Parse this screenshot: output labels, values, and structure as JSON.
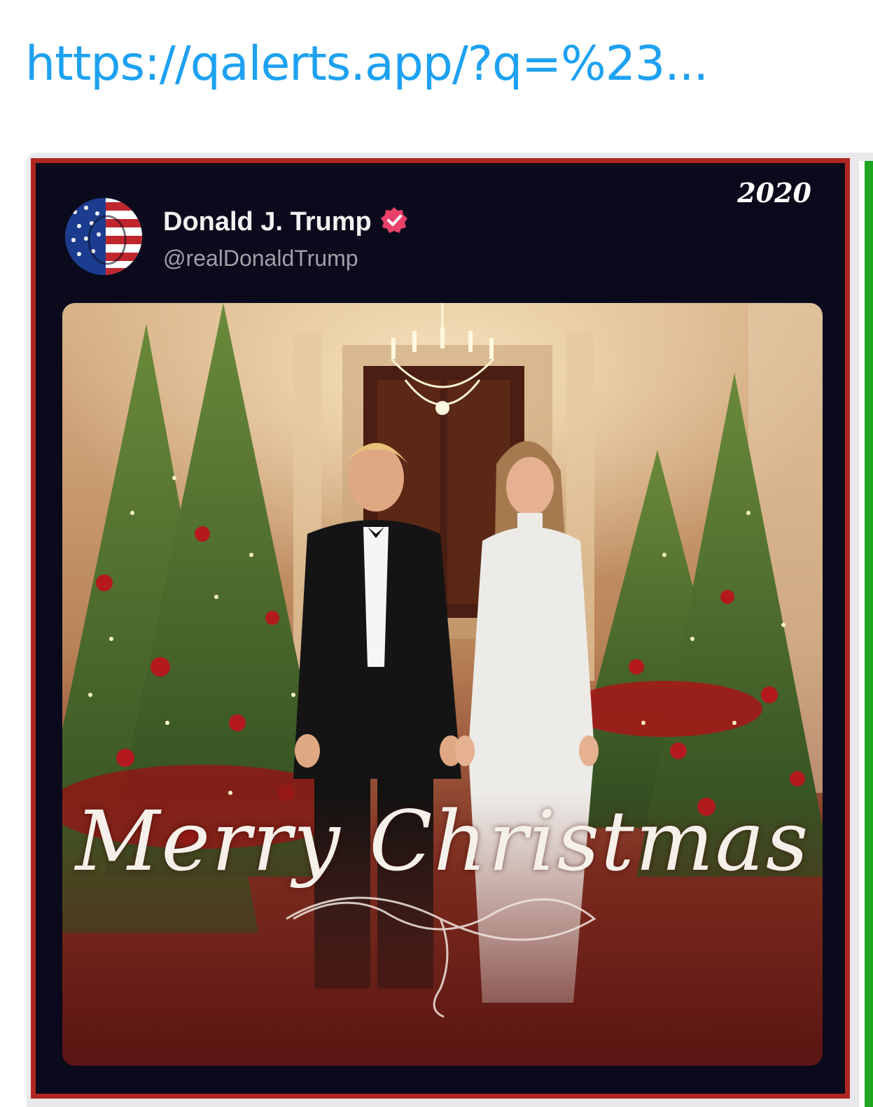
{
  "link": {
    "text": "https://qalerts.app/?q=%23..."
  },
  "post": {
    "year": "2020",
    "author_name": "Donald J. Trump",
    "author_handle": "@realDonaldTrump",
    "verified_icon": "verified-badge-icon",
    "greeting": "Merry Christmas"
  },
  "colors": {
    "link": "#1da1f2",
    "post_background": "#0a0a1c",
    "post_border": "#b12622",
    "frame_accent": "#1fa51f",
    "verified_badge": "#e8426b"
  }
}
